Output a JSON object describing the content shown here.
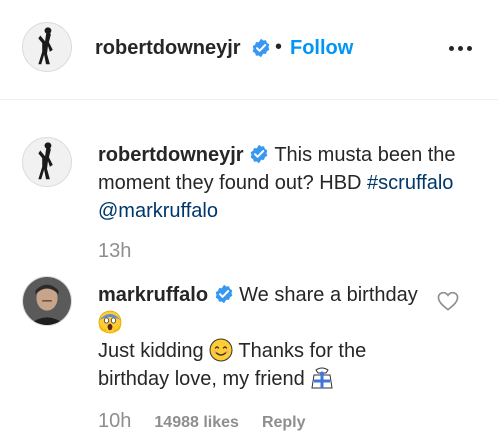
{
  "post_header": {
    "username": "robertdowneyjr",
    "separator": "•",
    "follow_label": "Follow",
    "more_icon": "more-options-icon"
  },
  "comments": [
    {
      "username": "robertdowneyjr",
      "verified": true,
      "text": "This musta been the moment they found out? HBD",
      "hashtag": "#scruffalo",
      "mention": "@markruffalo",
      "time": "13h"
    },
    {
      "username": "markruffalo",
      "verified": true,
      "text_part1": "We share a birthday",
      "text_part2": "Just kidding",
      "text_part3": "Thanks for the birthday love, my friend",
      "emojis": [
        "face-screaming-in-fear-icon",
        "smiling-face-icon",
        "present-icon"
      ],
      "time": "10h",
      "likes": "14988 likes",
      "reply_label": "Reply"
    }
  ],
  "colors": {
    "follow_blue": "#0095f6",
    "verified_blue": "#3897f0",
    "tag_link": "#00376b",
    "muted": "#8e8e8e",
    "text": "#262626"
  }
}
